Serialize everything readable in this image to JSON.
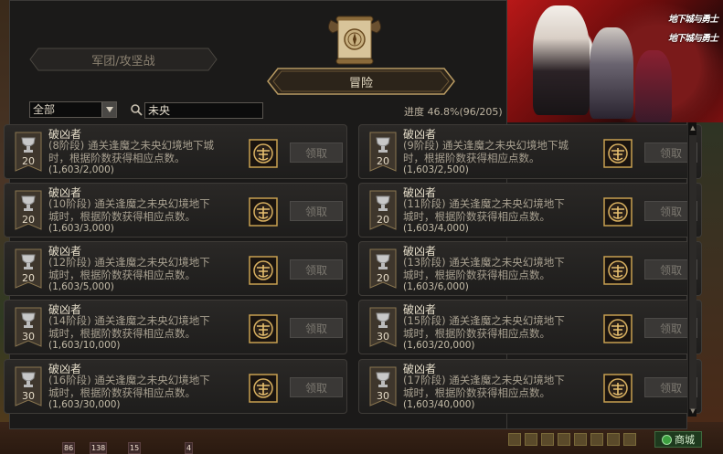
{
  "tabs": {
    "inactive_label": "军团/攻坚战",
    "active_label": "冒险"
  },
  "filter": {
    "category_selected": "全部",
    "search_value": "未央"
  },
  "progress": {
    "label": "进度 46.8%(96/205)",
    "percent": 46.8,
    "done": 96,
    "total": 205
  },
  "achievements": [
    {
      "title": "破凶者",
      "desc": "(8阶段) 通关逢魔之未央幻境地下城时，根据阶数获得相应点数。",
      "req": "(1,603/2,000)",
      "badge": "20",
      "claim": "领取"
    },
    {
      "title": "破凶者",
      "desc": "(9阶段) 通关逢魔之未央幻境地下城时，根据阶数获得相应点数。",
      "req": "(1,603/2,500)",
      "badge": "20",
      "claim": "领取"
    },
    {
      "title": "破凶者",
      "desc": "(10阶段) 通关逢魔之未央幻境地下城时，根据阶数获得相应点数。",
      "req": "(1,603/3,000)",
      "badge": "20",
      "claim": "领取"
    },
    {
      "title": "破凶者",
      "desc": "(11阶段) 通关逢魔之未央幻境地下城时，根据阶数获得相应点数。",
      "req": "(1,603/4,000)",
      "badge": "20",
      "claim": "领取"
    },
    {
      "title": "破凶者",
      "desc": "(12阶段) 通关逢魔之未央幻境地下城时，根据阶数获得相应点数。",
      "req": "(1,603/5,000)",
      "badge": "20",
      "claim": "领取"
    },
    {
      "title": "破凶者",
      "desc": "(13阶段) 通关逢魔之未央幻境地下城时，根据阶数获得相应点数。",
      "req": "(1,603/6,000)",
      "badge": "20",
      "claim": "领取"
    },
    {
      "title": "破凶者",
      "desc": "(14阶段) 通关逢魔之未央幻境地下城时，根据阶数获得相应点数。",
      "req": "(1,603/10,000)",
      "badge": "30",
      "claim": "领取"
    },
    {
      "title": "破凶者",
      "desc": "(15阶段) 通关逢魔之未央幻境地下城时，根据阶数获得相应点数。",
      "req": "(1,603/20,000)",
      "badge": "30",
      "claim": "领取"
    },
    {
      "title": "破凶者",
      "desc": "(16阶段) 通关逢魔之未央幻境地下城时，根据阶数获得相应点数。",
      "req": "(1,603/30,000)",
      "badge": "30",
      "claim": "领取"
    },
    {
      "title": "破凶者",
      "desc": "(17阶段) 通关逢魔之未央幻境地下城时，根据阶数获得相应点数。",
      "req": "(1,603/40,000)",
      "badge": "30",
      "claim": "领取"
    }
  ],
  "banner": {
    "logo_text": "地下城与勇士"
  },
  "hud": {
    "slots": [
      "86",
      "138",
      "15",
      "4"
    ],
    "shop_label": "商城"
  },
  "colors": {
    "panel_bg": "#1b1a19",
    "card_bg": "#2a2826",
    "gold": "#c8a050",
    "text": "#cfc6b4"
  },
  "icons": {
    "trophy": "trophy-icon",
    "reward": "emblem-icon",
    "search": "search-icon",
    "dropdown": "dropdown-arrow-icon"
  }
}
